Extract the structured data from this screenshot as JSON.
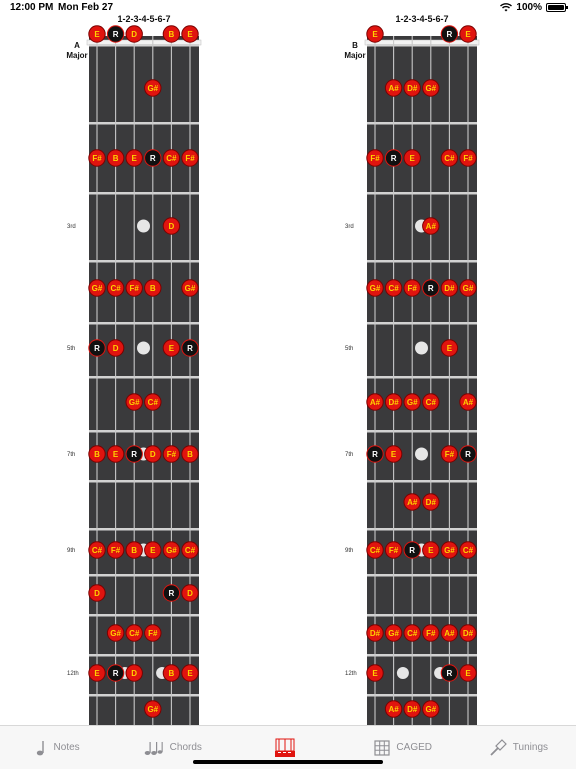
{
  "status": {
    "time": "12:00 PM",
    "date": "Mon Feb 27",
    "battery": "100%"
  },
  "diagrams": [
    {
      "header": "1-2-3-4-5-6-7",
      "key": "A",
      "scale": "Major",
      "dots": [
        {
          "s": 0,
          "f": 0,
          "l": "E"
        },
        {
          "s": 1,
          "f": 0,
          "l": "R"
        },
        {
          "s": 2,
          "f": 0,
          "l": "D"
        },
        {
          "s": 4,
          "f": 0,
          "l": "B"
        },
        {
          "s": 5,
          "f": 0,
          "l": "E"
        },
        {
          "s": 3,
          "f": 1,
          "l": "G#"
        },
        {
          "s": 0,
          "f": 2,
          "l": "F#"
        },
        {
          "s": 1,
          "f": 2,
          "l": "B"
        },
        {
          "s": 2,
          "f": 2,
          "l": "E"
        },
        {
          "s": 3,
          "f": 2,
          "l": "R"
        },
        {
          "s": 4,
          "f": 2,
          "l": "C#"
        },
        {
          "s": 5,
          "f": 2,
          "l": "F#"
        },
        {
          "s": 4,
          "f": 3,
          "l": "D"
        },
        {
          "s": 0,
          "f": 4,
          "l": "G#"
        },
        {
          "s": 1,
          "f": 4,
          "l": "C#"
        },
        {
          "s": 2,
          "f": 4,
          "l": "F#"
        },
        {
          "s": 3,
          "f": 4,
          "l": "B"
        },
        {
          "s": 5,
          "f": 4,
          "l": "G#"
        },
        {
          "s": 0,
          "f": 5,
          "l": "R"
        },
        {
          "s": 1,
          "f": 5,
          "l": "D"
        },
        {
          "s": 4,
          "f": 5,
          "l": "E"
        },
        {
          "s": 5,
          "f": 5,
          "l": "R"
        },
        {
          "s": 2,
          "f": 6,
          "l": "G#"
        },
        {
          "s": 3,
          "f": 6,
          "l": "C#"
        },
        {
          "s": 0,
          "f": 7,
          "l": "B"
        },
        {
          "s": 1,
          "f": 7,
          "l": "E"
        },
        {
          "s": 2,
          "f": 7,
          "l": "R"
        },
        {
          "s": 3,
          "f": 7,
          "l": "D"
        },
        {
          "s": 4,
          "f": 7,
          "l": "F#"
        },
        {
          "s": 5,
          "f": 7,
          "l": "B"
        },
        {
          "s": 0,
          "f": 9,
          "l": "C#"
        },
        {
          "s": 1,
          "f": 9,
          "l": "F#"
        },
        {
          "s": 2,
          "f": 9,
          "l": "B"
        },
        {
          "s": 3,
          "f": 9,
          "l": "E"
        },
        {
          "s": 4,
          "f": 9,
          "l": "G#"
        },
        {
          "s": 5,
          "f": 9,
          "l": "C#"
        },
        {
          "s": 0,
          "f": 10,
          "l": "D"
        },
        {
          "s": 4,
          "f": 10,
          "l": "R"
        },
        {
          "s": 5,
          "f": 10,
          "l": "D"
        },
        {
          "s": 1,
          "f": 11,
          "l": "G#"
        },
        {
          "s": 2,
          "f": 11,
          "l": "C#"
        },
        {
          "s": 3,
          "f": 11,
          "l": "F#"
        },
        {
          "s": 0,
          "f": 12,
          "l": "E"
        },
        {
          "s": 1,
          "f": 12,
          "l": "R"
        },
        {
          "s": 2,
          "f": 12,
          "l": "D"
        },
        {
          "s": 4,
          "f": 12,
          "l": "B"
        },
        {
          "s": 5,
          "f": 12,
          "l": "E"
        },
        {
          "s": 3,
          "f": 13,
          "l": "G#"
        }
      ]
    },
    {
      "header": "1-2-3-4-5-6-7",
      "key": "B",
      "scale": "Major",
      "dots": [
        {
          "s": 0,
          "f": 0,
          "l": "E"
        },
        {
          "s": 4,
          "f": 0,
          "l": "R"
        },
        {
          "s": 5,
          "f": 0,
          "l": "E"
        },
        {
          "s": 1,
          "f": 1,
          "l": "A#"
        },
        {
          "s": 2,
          "f": 1,
          "l": "D#"
        },
        {
          "s": 3,
          "f": 1,
          "l": "G#"
        },
        {
          "s": 0,
          "f": 2,
          "l": "F#"
        },
        {
          "s": 1,
          "f": 2,
          "l": "R"
        },
        {
          "s": 2,
          "f": 2,
          "l": "E"
        },
        {
          "s": 4,
          "f": 2,
          "l": "C#"
        },
        {
          "s": 5,
          "f": 2,
          "l": "F#"
        },
        {
          "s": 3,
          "f": 3,
          "l": "A#"
        },
        {
          "s": 0,
          "f": 4,
          "l": "G#"
        },
        {
          "s": 1,
          "f": 4,
          "l": "C#"
        },
        {
          "s": 2,
          "f": 4,
          "l": "F#"
        },
        {
          "s": 3,
          "f": 4,
          "l": "R"
        },
        {
          "s": 4,
          "f": 4,
          "l": "D#"
        },
        {
          "s": 5,
          "f": 4,
          "l": "G#"
        },
        {
          "s": 4,
          "f": 5,
          "l": "E"
        },
        {
          "s": 0,
          "f": 6,
          "l": "A#"
        },
        {
          "s": 1,
          "f": 6,
          "l": "D#"
        },
        {
          "s": 2,
          "f": 6,
          "l": "G#"
        },
        {
          "s": 3,
          "f": 6,
          "l": "C#"
        },
        {
          "s": 5,
          "f": 6,
          "l": "A#"
        },
        {
          "s": 0,
          "f": 7,
          "l": "R"
        },
        {
          "s": 1,
          "f": 7,
          "l": "E"
        },
        {
          "s": 4,
          "f": 7,
          "l": "F#"
        },
        {
          "s": 5,
          "f": 7,
          "l": "R"
        },
        {
          "s": 2,
          "f": 8,
          "l": "A#"
        },
        {
          "s": 3,
          "f": 8,
          "l": "D#"
        },
        {
          "s": 0,
          "f": 9,
          "l": "C#"
        },
        {
          "s": 1,
          "f": 9,
          "l": "F#"
        },
        {
          "s": 2,
          "f": 9,
          "l": "R"
        },
        {
          "s": 3,
          "f": 9,
          "l": "E"
        },
        {
          "s": 4,
          "f": 9,
          "l": "G#"
        },
        {
          "s": 5,
          "f": 9,
          "l": "C#"
        },
        {
          "s": 0,
          "f": 11,
          "l": "D#"
        },
        {
          "s": 1,
          "f": 11,
          "l": "G#"
        },
        {
          "s": 2,
          "f": 11,
          "l": "C#"
        },
        {
          "s": 3,
          "f": 11,
          "l": "F#"
        },
        {
          "s": 4,
          "f": 11,
          "l": "A#"
        },
        {
          "s": 5,
          "f": 11,
          "l": "D#"
        },
        {
          "s": 0,
          "f": 12,
          "l": "E"
        },
        {
          "s": 4,
          "f": 12,
          "l": "R"
        },
        {
          "s": 5,
          "f": 12,
          "l": "E"
        },
        {
          "s": 1,
          "f": 13,
          "l": "A#"
        },
        {
          "s": 2,
          "f": 13,
          "l": "D#"
        },
        {
          "s": 3,
          "f": 13,
          "l": "G#"
        }
      ]
    }
  ],
  "fret_labels": [
    {
      "f": 3,
      "label": "3rd"
    },
    {
      "f": 5,
      "label": "5th"
    },
    {
      "f": 7,
      "label": "7th"
    },
    {
      "f": 9,
      "label": "9th"
    },
    {
      "f": 12,
      "label": "12th"
    }
  ],
  "inlays": [
    3,
    5,
    7,
    9,
    12
  ],
  "colors": {
    "dot_fill": "#e0140f",
    "dot_stroke": "#7a0000",
    "note_text": "#ffd200",
    "root_fill": "#111111",
    "root_text": "#ffffff",
    "board": "#3a3a3c",
    "fret": "#d2d2d2",
    "string": "#c8c8c8",
    "accent": "#e0140f"
  },
  "tabs": [
    {
      "label": "Notes",
      "icon": "music-note-icon",
      "active": false
    },
    {
      "label": "Chords",
      "icon": "music-notes-icon",
      "active": false
    },
    {
      "label": "",
      "icon": "app-logo-icon",
      "active": true
    },
    {
      "label": "CAGED",
      "icon": "grid-icon",
      "active": false
    },
    {
      "label": "Tunings",
      "icon": "tuning-fork-icon",
      "active": false
    }
  ]
}
